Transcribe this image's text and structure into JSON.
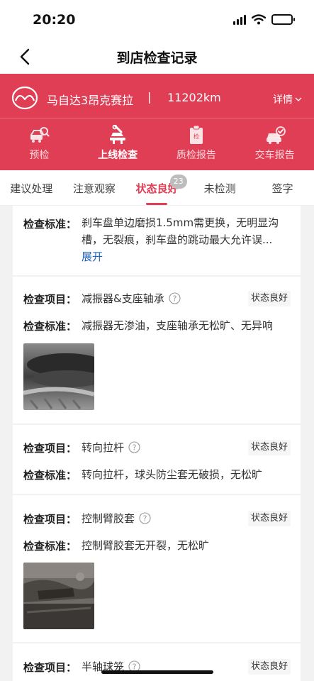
{
  "status_bar": {
    "time": "20:20"
  },
  "nav": {
    "title": "到店检查记录"
  },
  "car": {
    "name": "马自达3昂克赛拉",
    "separator": "|",
    "mileage": "11202km",
    "detail_label": "详情"
  },
  "stages": [
    {
      "label": "预检",
      "icon": "car-search-icon"
    },
    {
      "label": "上线检查",
      "icon": "lift-check-icon"
    },
    {
      "label": "质检报告",
      "icon": "clipboard-icon"
    },
    {
      "label": "交车报告",
      "icon": "car-check-icon"
    }
  ],
  "tabs": [
    {
      "label": "建议处理"
    },
    {
      "label": "注意观察"
    },
    {
      "label": "状态良好",
      "badge": "23"
    },
    {
      "label": "未检测"
    },
    {
      "label": "签字"
    }
  ],
  "labels": {
    "item": "检查项目：",
    "standard": "检查标准："
  },
  "first_card": {
    "standard_line1": "刹车盘单边磨损1.5mm需更换，无明显沟",
    "standard_line2": "槽，无裂痕，刹车盘的跳动最大允许误...",
    "expand_label": "展开"
  },
  "items": [
    {
      "name": "减振器&支座轴承",
      "status": "状态良好",
      "standard": "减振器无渗油，支座轴承无松旷、无异响"
    },
    {
      "name": "转向拉杆",
      "status": "状态良好",
      "standard": "转向拉杆，球头防尘套无破损，无松旷"
    },
    {
      "name": "控制臂胶套",
      "status": "状态良好",
      "standard": "控制臂胶套无开裂，无松旷"
    },
    {
      "name": "半轴球笼",
      "status": "状态良好"
    }
  ],
  "colors": {
    "brand_red": "#e03e55",
    "link_blue": "#1a63c4"
  }
}
